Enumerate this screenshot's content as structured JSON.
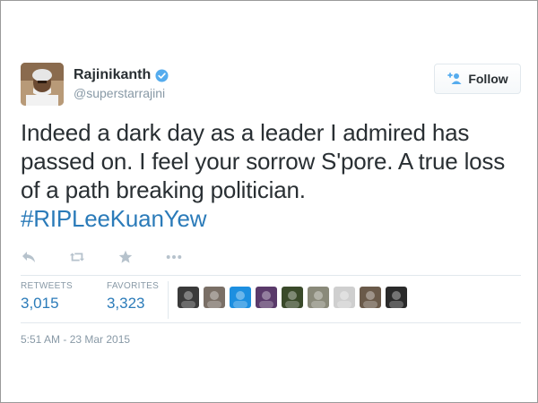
{
  "user": {
    "display_name": "Rajinikanth",
    "handle": "@superstarrajini",
    "verified": true
  },
  "follow_button": {
    "label": "Follow"
  },
  "tweet": {
    "text": "Indeed a dark day as a leader I admired has passed on. I feel your sorrow S'pore. A true loss of a path breaking politician.",
    "hashtag": "#RIPLeeKuanYew"
  },
  "actions": [
    {
      "icon": "reply-icon"
    },
    {
      "icon": "retweet-icon"
    },
    {
      "icon": "favorite-star-icon"
    },
    {
      "icon": "more-icon"
    }
  ],
  "stats": {
    "retweets_label": "RETWEETS",
    "retweets_value": "3,015",
    "favorites_label": "FAVORITES",
    "favorites_value": "3,323"
  },
  "favoriter_avatars": [
    {
      "color": "#3a3a3a"
    },
    {
      "color": "#7a6f66"
    },
    {
      "color": "#1d8fe0"
    },
    {
      "color": "#5a3a6a"
    },
    {
      "color": "#3a4a2a"
    },
    {
      "color": "#8a8a7a"
    },
    {
      "color": "#cfcfcf"
    },
    {
      "color": "#6a5a4a"
    },
    {
      "color": "#2a2a2a"
    }
  ],
  "timestamp": "5:51 AM - 23 Mar 2015",
  "colors": {
    "link": "#2b7bb9",
    "muted": "#8899a6",
    "text": "#292f33",
    "verified": "#55acee"
  }
}
